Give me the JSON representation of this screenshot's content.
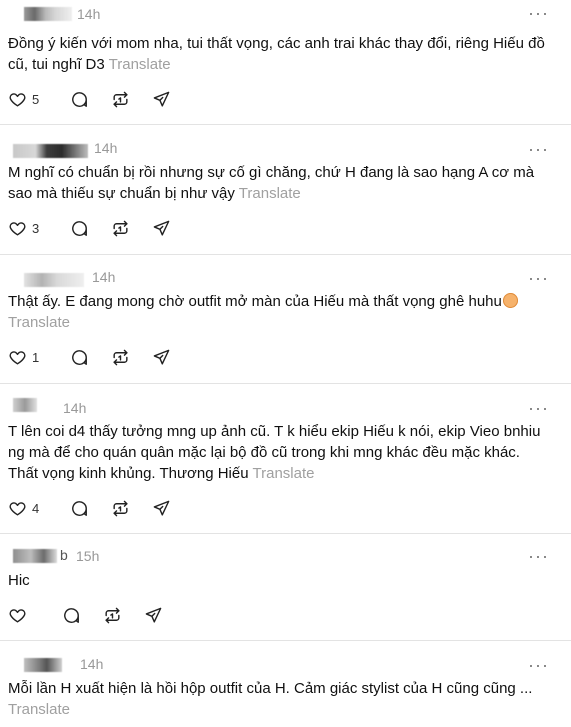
{
  "posts": [
    {
      "time": "14h",
      "text": "Đồng ý kiến với mom nha, tui thất vọng, các anh trai khác thay đổi, riêng Hiếu đồ cũ, tui nghĩ D3",
      "translate": "Translate",
      "likes": "5"
    },
    {
      "time": "14h",
      "text": "M nghĩ có chuẩn bị rồi nhưng sự cố gì chăng, chứ H đang là sao hạng A cơ mà sao mà thiếu sự chuẩn bị như vậy",
      "translate": "Translate",
      "likes": "3"
    },
    {
      "time": "14h",
      "text": "Thật ấy. E đang mong chờ outfit mở màn của Hiếu mà thất vọng ghê huhu",
      "emoji": "pleading-face-emoji",
      "translate": "Translate",
      "likes": "1"
    },
    {
      "time": "14h",
      "text": "T lên coi d4 thấy tưởng mng up ảnh cũ. T k hiểu ekip Hiếu k nói, ekip Vieo bnhiu ng mà để cho quán quân mặc lại bộ đồ cũ trong khi mng khác đều mặc khác. Thất vọng kinh khủng. Thương Hiếu",
      "translate": "Translate",
      "likes": "4"
    },
    {
      "time": "15h",
      "username_trail": "b",
      "text": "Hic",
      "translate": "",
      "likes": ""
    },
    {
      "time": "14h",
      "text": "Mỗi lần H xuất hiện là hồi hộp outfit của H. Cảm giác stylist của H cũng cũng ...",
      "translate": "Translate",
      "likes": ""
    }
  ],
  "icons": {
    "like": "heart-icon",
    "reply": "comment-bubble-icon",
    "repost": "repost-icon",
    "share": "send-icon",
    "more": "more-dots-icon"
  },
  "more_label": "···"
}
